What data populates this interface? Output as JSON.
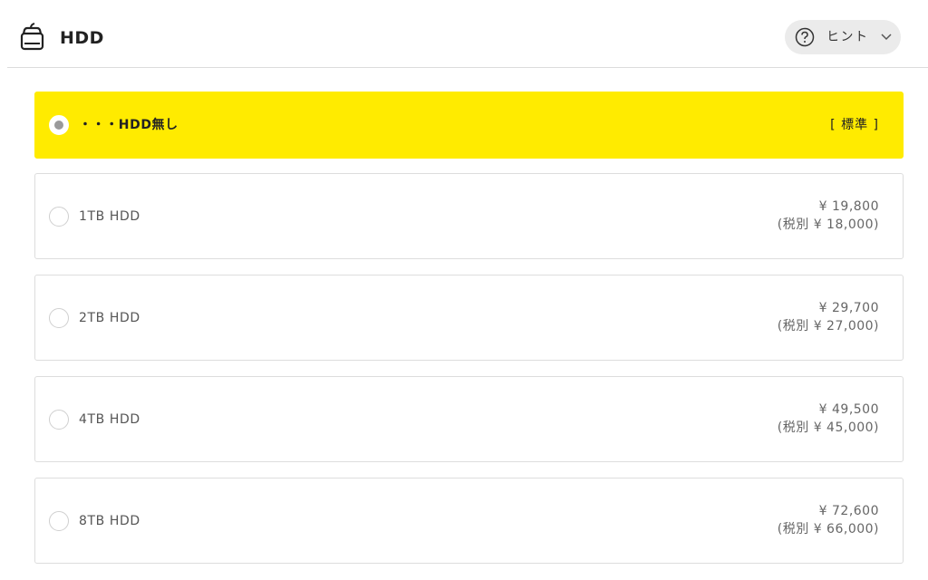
{
  "header": {
    "icon": "hdd-icon",
    "title": "HDD",
    "hint_label": "ヒント",
    "hint_icon": "question-circle-icon",
    "chevron_icon": "chevron-down-icon"
  },
  "colors": {
    "selected_bg": "#ffeb00",
    "border": "#dddddd",
    "hint_bg": "#ebebeb"
  },
  "options": [
    {
      "label": "・・・HDD無し",
      "tag": "[ 標準 ]",
      "selected": true
    },
    {
      "label": "1TB HDD",
      "price": "¥ 19,800",
      "price_ex": "(税別 ¥ 18,000)",
      "selected": false
    },
    {
      "label": "2TB HDD",
      "price": "¥ 29,700",
      "price_ex": "(税別 ¥ 27,000)",
      "selected": false
    },
    {
      "label": "4TB HDD",
      "price": "¥ 49,500",
      "price_ex": "(税別 ¥ 45,000)",
      "selected": false
    },
    {
      "label": "8TB HDD",
      "price": "¥ 72,600",
      "price_ex": "(税別 ¥ 66,000)",
      "selected": false
    }
  ]
}
